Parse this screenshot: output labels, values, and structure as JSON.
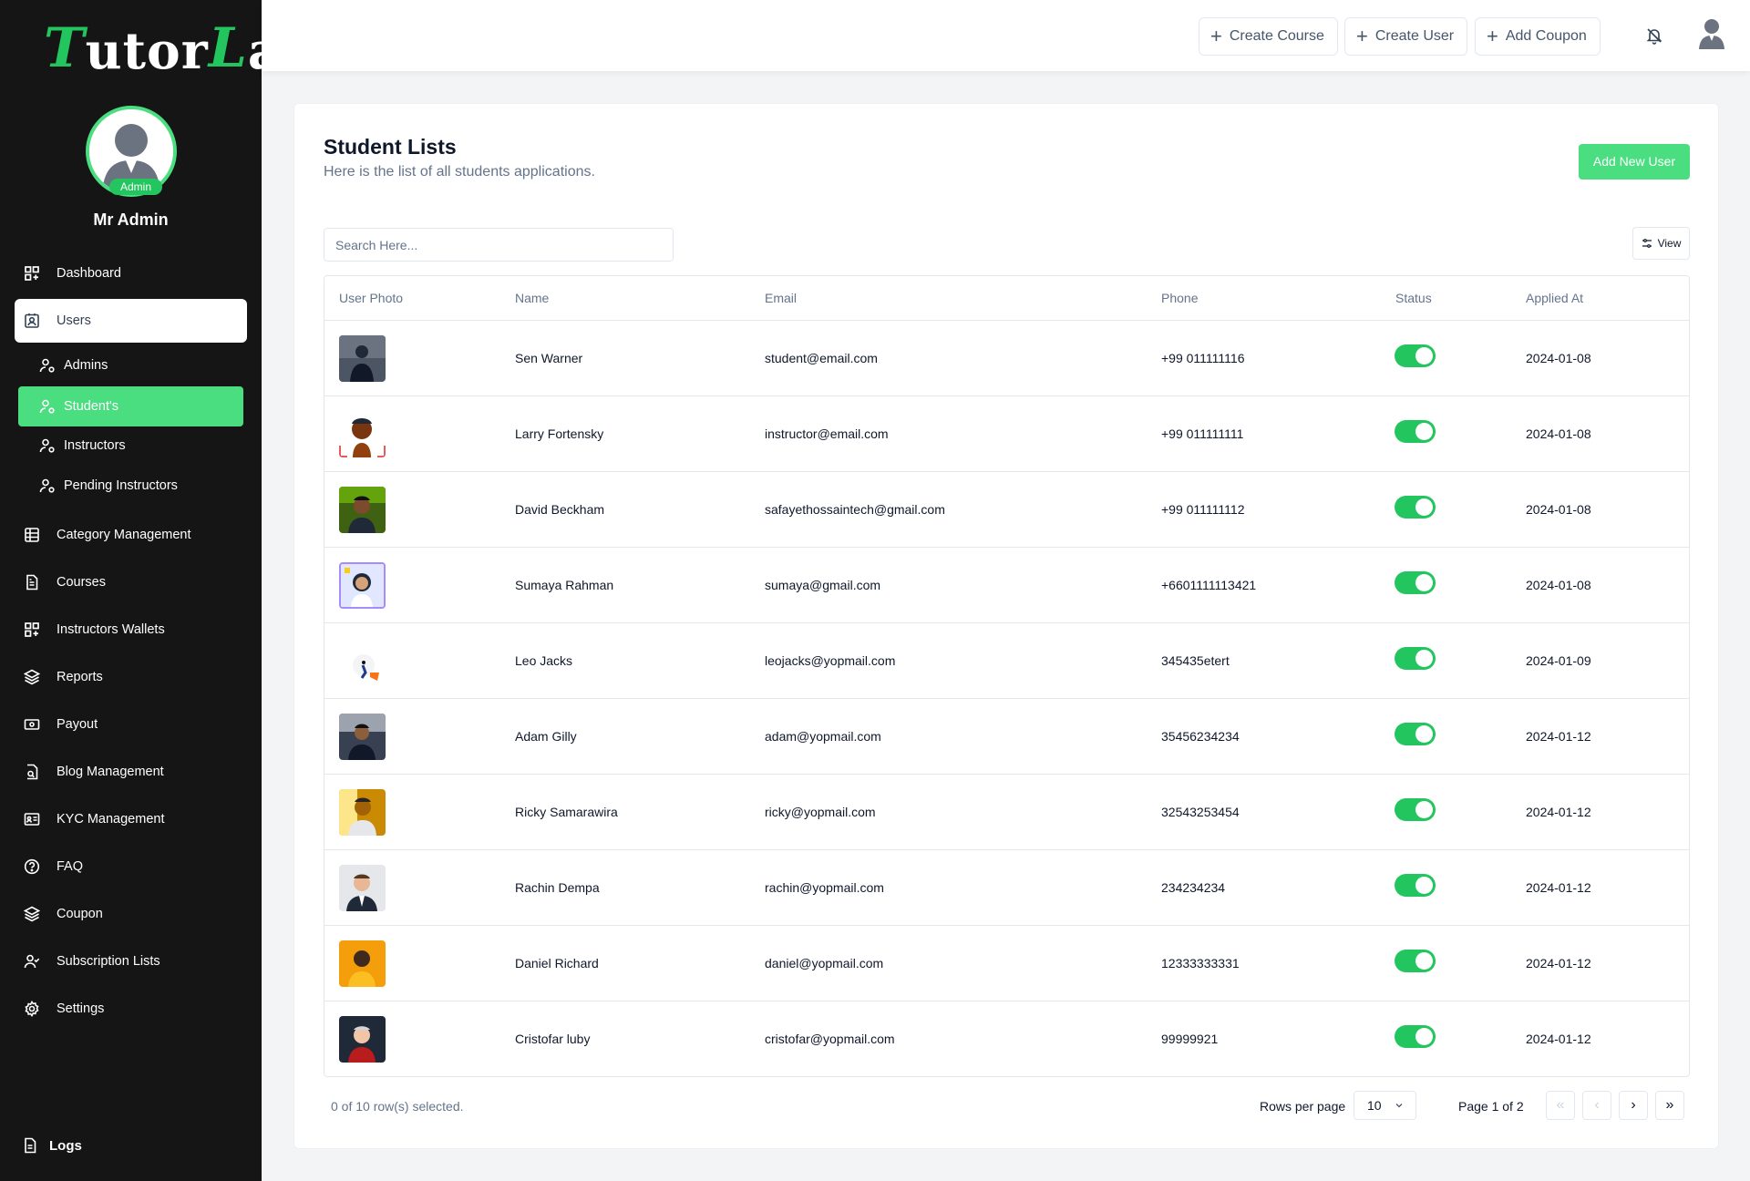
{
  "brand": {
    "logo_text_a": "T",
    "logo_text_b": "utor",
    "logo_text_c": "L",
    "logo_text_d": "ab",
    "accent": "#22c55e"
  },
  "profile": {
    "badge": "Admin",
    "name": "Mr Admin"
  },
  "sidebar": {
    "items": [
      {
        "label": "Dashboard",
        "icon": "dashboard-icon"
      },
      {
        "label": "Users",
        "icon": "contact-card-icon"
      },
      {
        "label": "Category Management",
        "icon": "table-icon"
      },
      {
        "label": "Courses",
        "icon": "file-icon"
      },
      {
        "label": "Instructors Wallets",
        "icon": "dashboard-icon"
      },
      {
        "label": "Reports",
        "icon": "layers-icon"
      },
      {
        "label": "Payout",
        "icon": "banknote-icon"
      },
      {
        "label": "Blog Management",
        "icon": "file-search-icon"
      },
      {
        "label": "KYC Management",
        "icon": "id-card-icon"
      },
      {
        "label": "FAQ",
        "icon": "help-circle-icon"
      },
      {
        "label": "Coupon",
        "icon": "layers-icon"
      },
      {
        "label": "Subscription Lists",
        "icon": "user-check-icon"
      },
      {
        "label": "Settings",
        "icon": "gear-icon"
      }
    ],
    "sub_items": [
      {
        "label": "Admins"
      },
      {
        "label": "Student's"
      },
      {
        "label": "Instructors"
      },
      {
        "label": "Pending Instructors"
      }
    ],
    "logs": "Logs"
  },
  "topbar": {
    "create_course": "Create Course",
    "create_user": "Create User",
    "add_coupon": "Add Coupon"
  },
  "page": {
    "title": "Student Lists",
    "subtitle": "Here is the list of all students applications.",
    "add_button": "Add New User",
    "search_placeholder": "Search Here...",
    "view_button": "View"
  },
  "table": {
    "columns": [
      "User Photo",
      "Name",
      "Email",
      "Phone",
      "Status",
      "Applied At"
    ],
    "rows": [
      {
        "name": "Sen Warner",
        "email": "student@email.com",
        "phone": "+99 011111116",
        "status": true,
        "applied": "2024-01-08"
      },
      {
        "name": "Larry Fortensky",
        "email": "instructor@email.com",
        "phone": "+99 011111111",
        "status": true,
        "applied": "2024-01-08"
      },
      {
        "name": "David Beckham",
        "email": "safayethossaintech@gmail.com",
        "phone": "+99 011111112",
        "status": true,
        "applied": "2024-01-08"
      },
      {
        "name": "Sumaya Rahman",
        "email": "sumaya@gmail.com",
        "phone": "+6601111113421",
        "status": true,
        "applied": "2024-01-08"
      },
      {
        "name": "Leo Jacks",
        "email": "leojacks@yopmail.com",
        "phone": "345435etert",
        "status": true,
        "applied": "2024-01-09"
      },
      {
        "name": "Adam Gilly",
        "email": "adam@yopmail.com",
        "phone": "35456234234",
        "status": true,
        "applied": "2024-01-12"
      },
      {
        "name": "Ricky Samarawira",
        "email": "ricky@yopmail.com",
        "phone": "32543253454",
        "status": true,
        "applied": "2024-01-12"
      },
      {
        "name": "Rachin Dempa",
        "email": "rachin@yopmail.com",
        "phone": "234234234",
        "status": true,
        "applied": "2024-01-12"
      },
      {
        "name": "Daniel Richard",
        "email": "daniel@yopmail.com",
        "phone": "12333333331",
        "status": true,
        "applied": "2024-01-12"
      },
      {
        "name": "Cristofar luby",
        "email": "cristofar@yopmail.com",
        "phone": "99999921",
        "status": true,
        "applied": "2024-01-12"
      }
    ]
  },
  "footer": {
    "selected": "0 of 10 row(s) selected.",
    "rows_per_page_label": "Rows per page",
    "rows_per_page_value": "10",
    "page_info": "Page 1 of 2"
  }
}
